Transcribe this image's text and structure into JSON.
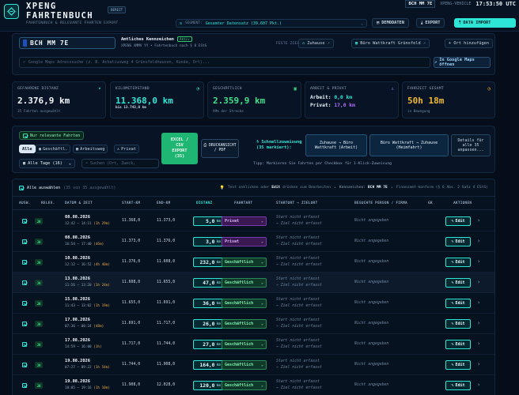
{
  "header": {
    "title_line1": "XPENG",
    "title_line2": "FAHRTENBUCH",
    "beta": "BEREIT",
    "subtitle": "FAHRTENBUCH & RELEVANTE FAHRTEN EXPORT",
    "plate": "BCH MM 7E",
    "vehicle": "XPENG-VEHICLE",
    "time": "17:53:50 UTC",
    "segment_label": "SEGMENT:",
    "segment_value": "Gesamter Datensatz (39.607 Pkt.)",
    "demo_label": "DEMODATEN",
    "export_label": "EXPORT",
    "import_label": "DATA IMPORT"
  },
  "vehicle": {
    "plate": "BCH MM 7E",
    "official_label": "Amtliches Kennzeichen",
    "active_badge": "Aktiv",
    "description": "XPENG XMMV YY • Fahrtenbuch nach § 8 EStG",
    "fixed_label": "FESTE ZIELE:",
    "dest1": "Zuhause",
    "dest2": "Büro Wattkraft Grünsfeld",
    "add_dest": "+ Ort hinzufügen",
    "search_placeholder": "Google Maps Adresssuche (z. B. Achatiusweg 4 Grünsfeldhausen, Kunde, Ort)...",
    "maps_btn": "In Google Maps öffnen"
  },
  "stats": [
    {
      "label": "GEFAHRENE DISTANZ",
      "value": "2.376,9 km",
      "sub": "35 Fahrten ausgewählt",
      "icon": "arrow-icon",
      "color": "#f2f7fc",
      "icon_color": "#2ee6d6"
    },
    {
      "label": "KILOMETERSTAND",
      "value": "11.368,0 km",
      "sub2": "bis 13.743,0 km",
      "icon": "gauge-icon",
      "color": "#f2f7fc",
      "icon_color": "#2ee6d6"
    },
    {
      "label": "GESCHÄFTLICH",
      "value": "2.359,9 km",
      "sub": "99% der Strecke",
      "icon": "briefcase-icon",
      "color": "#3ee08a",
      "icon_color": "#3ee08a"
    },
    {
      "label": "ARBEIT & PRIVAT",
      "line1_label": "Arbeit:",
      "line1_value": "0,0 km",
      "line2_label": "Privat:",
      "line2_value": "17,0 km",
      "icon": "user-icon",
      "icon_color": "#b070ff"
    },
    {
      "label": "FAHRZEIT GESAMT",
      "value": "50h 18m",
      "sub": "in Bewegung",
      "icon": "clock-icon",
      "color": "#f0b830",
      "icon_color": "#f0b830"
    }
  ],
  "filters": {
    "relevant_label": "Nur relevante Fahrten",
    "pills": [
      "Alle",
      "Geschäftl.",
      "Arbeitsweg",
      "Privat"
    ],
    "days": "Alle Tage (16)",
    "search_placeholder": "Suchen (Ort, Zweck,",
    "excel_line1": "EXCEL /",
    "excel_line2": "CSV",
    "excel_line3": "EXPORT",
    "excel_line4": "(35)",
    "print_line1": "DRUCKANSICHT",
    "print_line2": "/ PDF",
    "quick_line1": "Schnellzuweisung",
    "quick_line2": "(35 markiert):",
    "quick1": "Zuhause → Büro Wattkraft (Arbeit)",
    "quick2": "Büro Wattkraft → Zuhause (Heimfahrt)",
    "details": "Details für alle 35 anpassen...",
    "tip": "Tipp: Markieren Sie Fahrten per Checkbox für 1-Klick-Zuweisung"
  },
  "table": {
    "select_all": "Alle auswählen",
    "selection_info": "(35 von 35 ausgewählt)",
    "hint_pre": "Text anklicken oder",
    "hint_edit": "Edit",
    "hint_post": "drücken zum Bearbeiten",
    "plate_label": "Kennzeichen:",
    "plate": "BCH MM 7E",
    "compliance": "Finanzamt-konform (§ 6 Abs. 2 Satz 4 EStG)",
    "columns": {
      "select": "AUSW.",
      "relevant": "RELEV.",
      "datetime": "DATUM & ZEIT",
      "start_km": "START-KM",
      "end_km": "END-KM",
      "distance": "DISTANZ",
      "trip_type": "FAHRTART",
      "route": "STARTORT → ZIELORT",
      "person": "BESUCHTE PERSON / FIRMA",
      "extra": "GR",
      "actions": "AKTIONEN"
    },
    "rows": [
      {
        "date": "08.08.2026",
        "time": "12:42 – 14:11",
        "dur": "(1h 29m)",
        "start_km": "11.368,0",
        "end_km": "11.373,0",
        "dist": "5,0",
        "type": "Privat",
        "kind": "privat"
      },
      {
        "date": "08.08.2026",
        "time": "16:54 – 17:40",
        "dur": "(46m)",
        "start_km": "11.373,0",
        "end_km": "11.376,0",
        "dist": "3,0",
        "type": "Privat",
        "kind": "privat"
      },
      {
        "date": "10.08.2026",
        "time": "12:12 – 16:52",
        "dur": "(4h 40m)",
        "start_km": "11.376,0",
        "end_km": "11.608,0",
        "dist": "232,0",
        "type": "Geschäftlich",
        "kind": "business"
      },
      {
        "date": "13.08.2026",
        "time": "11:56 – 13:20",
        "dur": "(1h 24m)",
        "start_km": "11.608,0",
        "end_km": "11.655,0",
        "dist": "47,0",
        "type": "Geschäftlich",
        "kind": "business"
      },
      {
        "date": "15.08.2026",
        "time": "11:43 – 13:02",
        "dur": "(1h 19m)",
        "start_km": "11.655,0",
        "end_km": "11.691,0",
        "dist": "36,0",
        "type": "Geschäftlich",
        "kind": "business"
      },
      {
        "date": "17.08.2026",
        "time": "07:36 – 08:24",
        "dur": "(48m)",
        "start_km": "11.691,0",
        "end_km": "11.717,0",
        "dist": "26,0",
        "type": "Geschäftlich",
        "kind": "business"
      },
      {
        "date": "17.08.2026",
        "time": "14:59 – 16:00",
        "dur": "(1h)",
        "start_km": "11.717,0",
        "end_km": "11.744,0",
        "dist": "27,0",
        "type": "Geschäftlich",
        "kind": "business"
      },
      {
        "date": "19.08.2026",
        "time": "07:27 – 09:22",
        "dur": "(1h 54m)",
        "start_km": "11.744,0",
        "end_km": "11.908,0",
        "dist": "164,0",
        "type": "Geschäftlich",
        "kind": "business"
      },
      {
        "date": "19.08.2026",
        "time": "18:05 – 19:16",
        "dur": "(1h 10m)",
        "start_km": "11.908,0",
        "end_km": "12.028,0",
        "dist": "120,0",
        "type": "Geschäftlich",
        "kind": "business"
      }
    ],
    "rel_badge": "JA",
    "start_placeholder": "Start nicht erfasst",
    "dest_placeholder": "→ Ziel nicht erfasst",
    "person_placeholder": "Nicht angegeben",
    "unit": "km",
    "edit_label": "Edit"
  }
}
